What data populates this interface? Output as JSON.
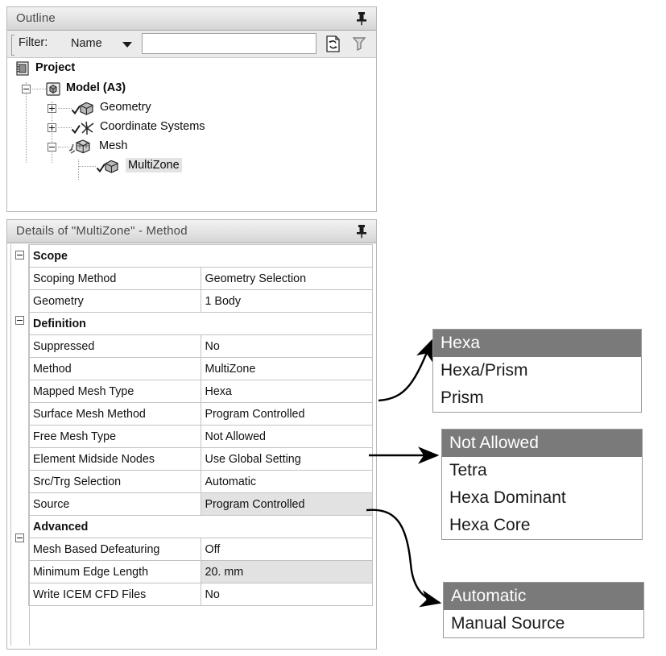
{
  "outline": {
    "title": "Outline",
    "pin_icon": "pin-icon",
    "filter": {
      "label": "Filter:",
      "select_value": "Name",
      "input_value": "",
      "input_placeholder": "",
      "refresh_icon": "refresh-document-icon",
      "extra_icon": "funnel-icon"
    },
    "tree": [
      {
        "label": "Project",
        "icon": "project-icon",
        "depth": 0,
        "expander": "none",
        "bold": true,
        "selected": false
      },
      {
        "label": "Model (A3)",
        "icon": "model-icon",
        "depth": 1,
        "expander": "minus",
        "bold": true,
        "selected": false
      },
      {
        "label": "Geometry",
        "icon": "geometry-icon",
        "depth": 2,
        "expander": "plus",
        "bold": false,
        "selected": false
      },
      {
        "label": "Coordinate Systems",
        "icon": "coordsys-icon",
        "depth": 2,
        "expander": "plus",
        "bold": false,
        "selected": false
      },
      {
        "label": "Mesh",
        "icon": "mesh-icon",
        "depth": 2,
        "expander": "minus",
        "bold": false,
        "selected": false
      },
      {
        "label": "MultiZone",
        "icon": "multizone-icon",
        "depth": 3,
        "expander": "none",
        "bold": false,
        "selected": true
      }
    ]
  },
  "details": {
    "title": "Details of \"MultiZone\" - Method",
    "pin_icon": "pin-icon",
    "rows": [
      {
        "type": "group",
        "name": "Scope"
      },
      {
        "type": "prop",
        "name": "Scoping Method",
        "value": "Geometry Selection",
        "highlight": false
      },
      {
        "type": "prop",
        "name": "Geometry",
        "value": "1 Body",
        "highlight": false
      },
      {
        "type": "group",
        "name": "Definition"
      },
      {
        "type": "prop",
        "name": "Suppressed",
        "value": "No",
        "highlight": false
      },
      {
        "type": "prop",
        "name": "Method",
        "value": "MultiZone",
        "highlight": false
      },
      {
        "type": "prop",
        "name": "Mapped Mesh Type",
        "value": "Hexa",
        "highlight": false
      },
      {
        "type": "prop",
        "name": "Surface Mesh Method",
        "value": "Program Controlled",
        "highlight": false
      },
      {
        "type": "prop",
        "name": "Free Mesh Type",
        "value": "Not Allowed",
        "highlight": false
      },
      {
        "type": "prop",
        "name": "Element Midside Nodes",
        "value": "Use Global Setting",
        "highlight": false
      },
      {
        "type": "prop",
        "name": "Src/Trg Selection",
        "value": "Automatic",
        "highlight": false
      },
      {
        "type": "prop",
        "name": "Source",
        "value": "Program Controlled",
        "highlight": true
      },
      {
        "type": "group",
        "name": "Advanced"
      },
      {
        "type": "prop",
        "name": "Mesh Based Defeaturing",
        "value": "Off",
        "highlight": false
      },
      {
        "type": "prop",
        "name": "Minimum Edge Length",
        "value": "20. mm",
        "highlight": true
      },
      {
        "type": "prop",
        "name": "Write ICEM CFD Files",
        "value": "No",
        "highlight": false
      }
    ]
  },
  "dropdowns": {
    "mapped_mesh_type": {
      "name": "Mapped Mesh Type",
      "options": [
        "Hexa",
        "Hexa/Prism",
        "Prism"
      ],
      "selected": "Hexa"
    },
    "free_mesh_type": {
      "name": "Free Mesh Type",
      "options": [
        "Not Allowed",
        "Tetra",
        "Hexa Dominant",
        "Hexa Core"
      ],
      "selected": "Not Allowed"
    },
    "src_trg_selection": {
      "name": "Src/Trg Selection",
      "options": [
        "Automatic",
        "Manual Source"
      ],
      "selected": "Automatic"
    }
  },
  "colors": {
    "selection_gray": "#7a7a7a",
    "highlight_gray": "#e2e2e2",
    "panel_border": "#b9b9b9",
    "grid_border": "#c3c3c3",
    "titlebar_bg": "#e3e3e3"
  }
}
